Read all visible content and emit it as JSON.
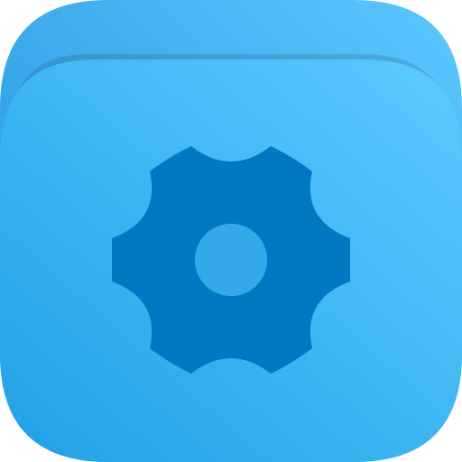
{
  "icon": {
    "name": "settings-folder-app-icon",
    "glyph": "gear-icon",
    "colors": {
      "back_light": "#5CC8FF",
      "back_dark": "#1E8FDA",
      "front_light": "#5CCBFF",
      "front_dark": "#22A0E6",
      "gear": "#0079C2",
      "hole": "#34A8E8"
    }
  }
}
